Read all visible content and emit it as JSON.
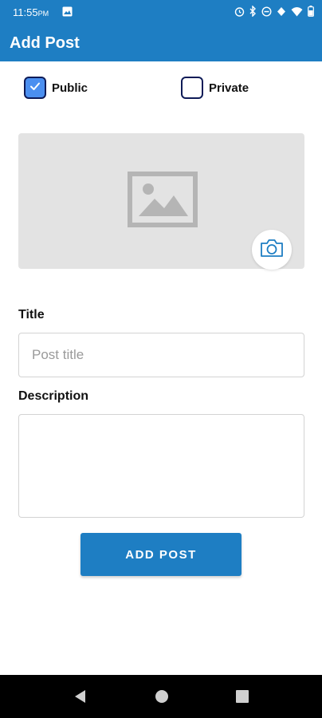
{
  "status_bar": {
    "time": "11:55",
    "ampm": "PM"
  },
  "app_bar": {
    "title": "Add Post"
  },
  "visibility": {
    "options": [
      {
        "label": "Public",
        "checked": true
      },
      {
        "label": "Private",
        "checked": false
      }
    ]
  },
  "form": {
    "title_label": "Title",
    "title_placeholder": "Post title",
    "title_value": "",
    "description_label": "Description",
    "description_value": "",
    "submit_label": "ADD POST"
  },
  "colors": {
    "primary": "#1e7ec3",
    "checkbox_checked": "#4b8ff0",
    "image_bg": "#e3e3e3"
  },
  "icons": [
    "image-placeholder-icon",
    "camera-icon",
    "back-icon",
    "home-icon",
    "recents-icon"
  ]
}
